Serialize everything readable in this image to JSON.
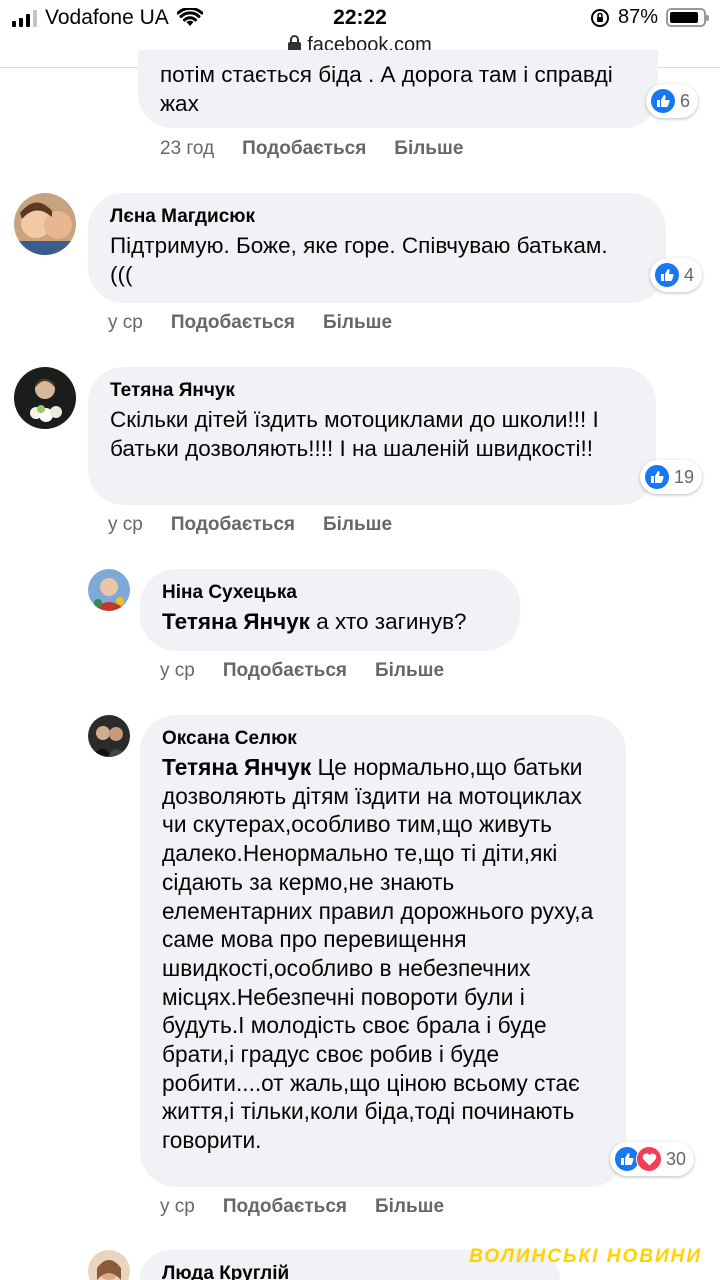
{
  "status_bar": {
    "carrier": "Vodafone UA",
    "time": "22:22",
    "battery": "87%",
    "battery_level": 0.87,
    "url": "facebook.com"
  },
  "actions": {
    "like": "Подобається",
    "more": "Більше"
  },
  "comments": [
    {
      "text": "потім стається біда . А дорога там і справді жах",
      "time": "23 год",
      "reactions": "6"
    },
    {
      "author": "Лєна Магдисюк",
      "text": "Підтримую. Боже, яке горе. Співчуваю батькам.(((",
      "time": "у ср",
      "reactions": "4"
    },
    {
      "author": "Тетяна Янчук",
      "text": "Скільки дітей їздить мотоциклами до школи!!! І батьки дозволяють!!!! І на шаленій швидкості!!",
      "time": "у ср",
      "reactions": "19"
    },
    {
      "author": "Ніна Сухецька",
      "mention": "Тетяна Янчук",
      "text": " а хто загинув?",
      "time": "у ср"
    },
    {
      "author": "Оксана Селюк",
      "mention": "Тетяна Янчук",
      "text": " Це нормально,що батьки дозволяють дітям їздити на мотоциклах чи скутерах,особливо тим,що живуть далеко.Ненормально те,що ті діти,які сідають за кермо,не знають елементарних правил дорожнього руху,а саме мова про перевищення швидкості,особливо в небезпечних місцях.Небезпечні повороти були і будуть.І молодість своє брала і буде брати,і градус своє робив і буде робити....от жаль,що ціною всьому стає життя,і тільки,коли біда,тоді починають говорити.",
      "time": "у ср",
      "reactions": "30"
    },
    {
      "author": "Люда Круглій"
    }
  ],
  "watermark": "ВОЛИНСЬКІ НОВИНИ",
  "icons": {
    "like": "like-reaction-icon",
    "love": "love-reaction-icon",
    "wifi": "wifi-icon",
    "lock": "lock-icon"
  },
  "colors": {
    "bubble": "#f0f2f5",
    "like_blue": "#1877f2",
    "love_red": "#f33e58",
    "secondary_text": "#65676b",
    "watermark": "#ffd200"
  }
}
